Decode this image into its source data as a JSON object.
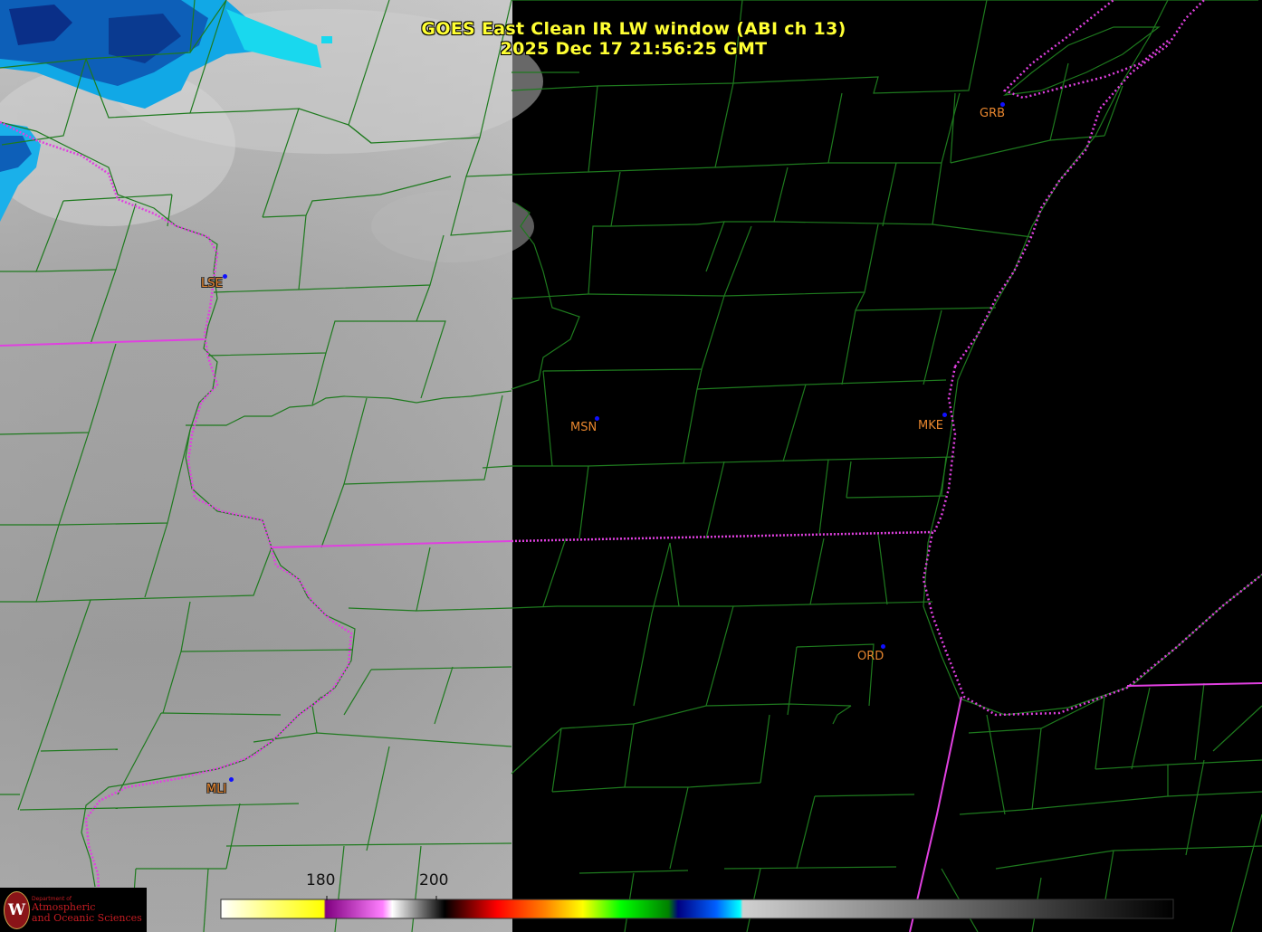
{
  "title": {
    "line1": "GOES East Clean IR LW window (ABI ch 13)",
    "line2": "2025 Dec 17  21:56:25 GMT"
  },
  "stations": [
    {
      "id": "GRB"
    },
    {
      "id": "LSE"
    },
    {
      "id": "MSN"
    },
    {
      "id": "MKE"
    },
    {
      "id": "ORD"
    },
    {
      "id": "MLI"
    }
  ],
  "colorbar": {
    "tick_labels": [
      "180",
      "200"
    ]
  },
  "logo": {
    "line1": "Department of",
    "line2": "Atmospheric",
    "line3": "and Oceanic Sciences",
    "emblem": "W"
  },
  "colors": {
    "county_lines": "#1e7a1e",
    "state_lines": "#e040e0",
    "title_text": "#ffff33",
    "station_text": "#e8862e",
    "station_dot": "#1010ff"
  }
}
